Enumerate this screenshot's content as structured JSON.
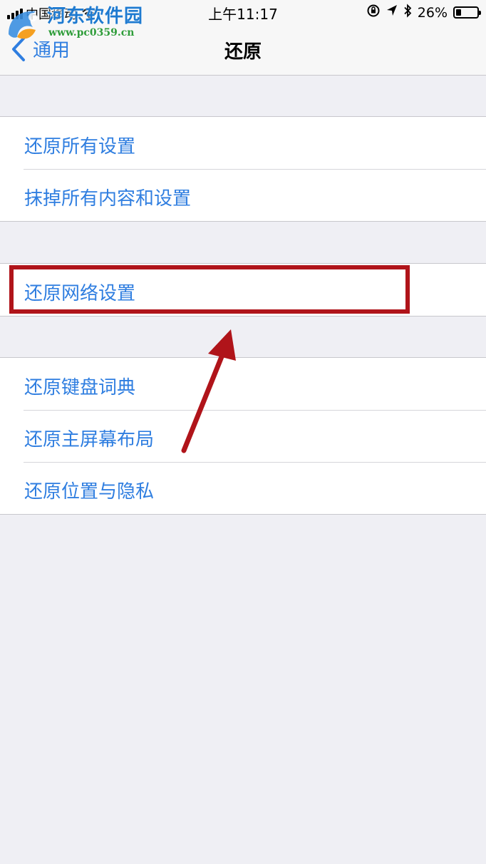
{
  "status_bar": {
    "carrier": "中国移动",
    "time": "上午11:17",
    "battery_percent": "26%",
    "battery_level": 0.26,
    "icons": [
      "signal-icon",
      "wifi-icon",
      "orientation-lock-icon",
      "location-icon",
      "bluetooth-icon",
      "battery-icon"
    ]
  },
  "nav": {
    "back_label": "通用",
    "title": "还原"
  },
  "watermark": {
    "title": "河东软件园",
    "url": "www.pc0359.cn"
  },
  "groups": [
    {
      "items": [
        {
          "label": "还原所有设置"
        },
        {
          "label": "抹掉所有内容和设置"
        }
      ]
    },
    {
      "items": [
        {
          "label": "还原网络设置"
        }
      ]
    },
    {
      "items": [
        {
          "label": "还原键盘词典"
        },
        {
          "label": "还原主屏幕布局"
        },
        {
          "label": "还原位置与隐私"
        }
      ]
    }
  ],
  "colors": {
    "accent": "#2f7ee0",
    "background": "#efeff4",
    "annotation": "#b0141a"
  }
}
